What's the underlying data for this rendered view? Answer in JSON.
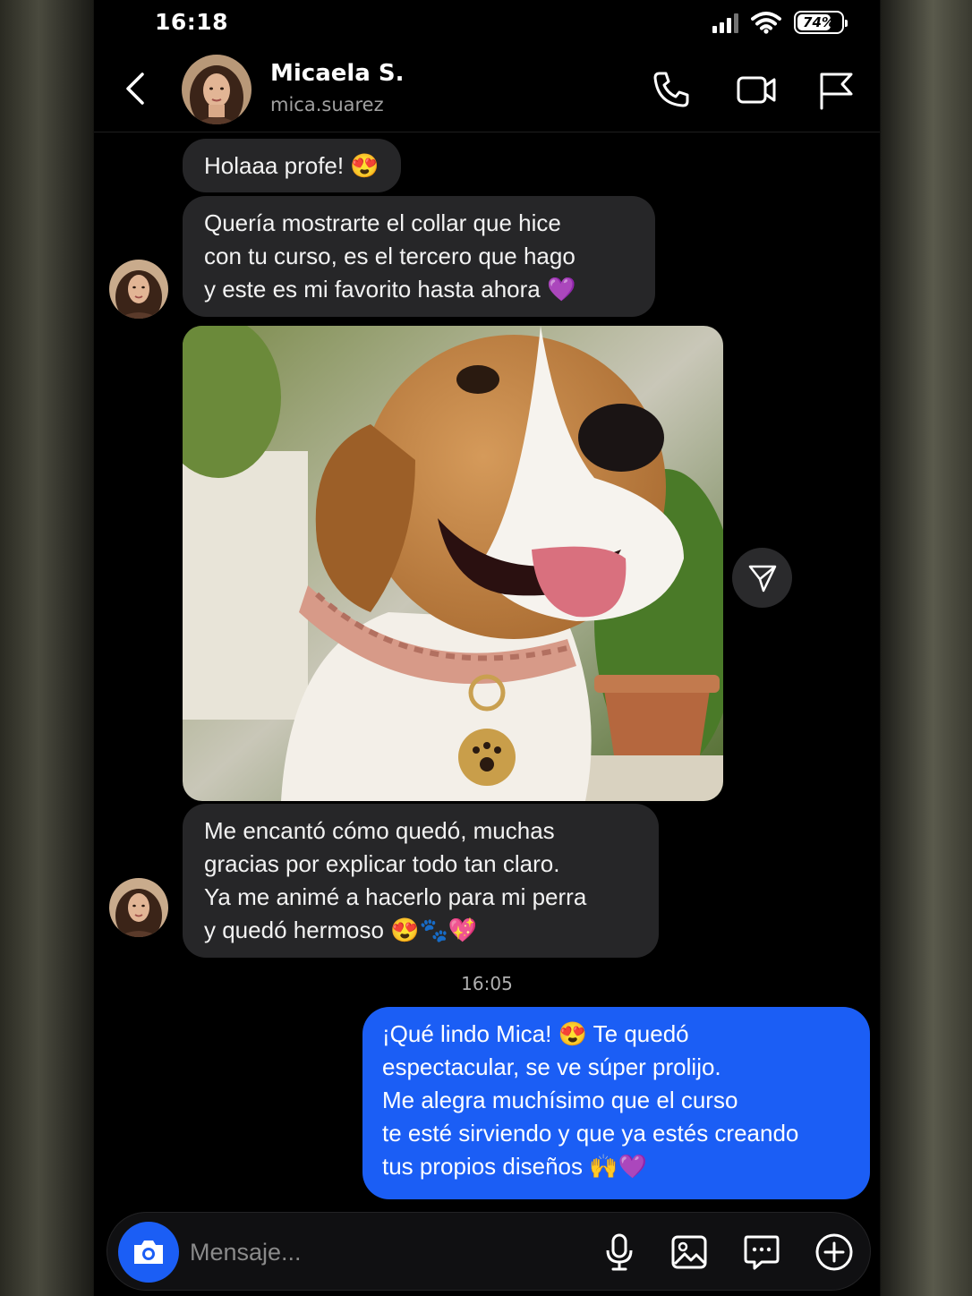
{
  "status_bar": {
    "time": "16:18",
    "battery": "74%",
    "icons": [
      "signal-icon",
      "wifi-icon",
      "battery-icon"
    ]
  },
  "header": {
    "contact_name": "Micaela S.",
    "username": "mica.suarez",
    "icons": [
      "back-icon",
      "phone-icon",
      "video-icon",
      "flag-icon"
    ]
  },
  "messages": {
    "m1": {
      "lines": [
        "Holaaa profe! 😍"
      ]
    },
    "m2": {
      "lines": [
        "Quería mostrarte el collar que hice",
        "con tu curso, es el tercero que hago",
        "y este es mi favorito hasta ahora 💜"
      ]
    },
    "photo": {
      "description_icon": "dog-photo"
    },
    "m3": {
      "lines": [
        "Me encantó cómo quedó, muchas",
        "gracias por explicar todo tan claro.",
        "Ya me animé a hacerlo para mi perra",
        "y quedó hermoso 😍🐾💖"
      ]
    },
    "timestamp": "16:05",
    "outgoing": {
      "lines": [
        "¡Qué lindo Mica! 😍 Te quedó",
        "espectacular, se ve súper prolijo.",
        "Me alegra muchísimo que el curso",
        "te esté sirviendo y que ya estés creando",
        "tus propios diseños 🙌💜"
      ]
    }
  },
  "composer": {
    "placeholder": "Mensaje...",
    "icons": [
      "camera-icon",
      "microphone-icon",
      "gallery-icon",
      "sticker-icon",
      "plus-icon"
    ]
  },
  "colors": {
    "accent": "#1b5ef5",
    "incoming_bubble": "#262628",
    "background": "#000000"
  }
}
